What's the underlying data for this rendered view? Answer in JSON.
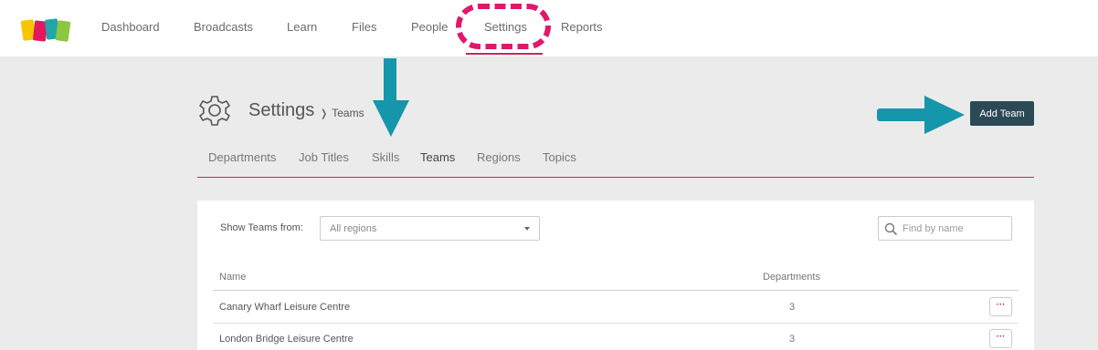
{
  "nav": {
    "items": [
      {
        "label": "Dashboard"
      },
      {
        "label": "Broadcasts"
      },
      {
        "label": "Learn"
      },
      {
        "label": "Files"
      },
      {
        "label": "People"
      },
      {
        "label": "Settings"
      },
      {
        "label": "Reports"
      }
    ],
    "active": "Settings"
  },
  "header": {
    "title": "Settings",
    "breadcrumb": "Teams",
    "add_button": "Add Team"
  },
  "tabs": [
    {
      "label": "Departments"
    },
    {
      "label": "Job Titles"
    },
    {
      "label": "Skills"
    },
    {
      "label": "Teams"
    },
    {
      "label": "Regions"
    },
    {
      "label": "Topics"
    }
  ],
  "active_tab": "Teams",
  "filter": {
    "label": "Show Teams from:",
    "selected": "All regions",
    "search_placeholder": "Find by name"
  },
  "table": {
    "columns": [
      "Name",
      "Departments"
    ],
    "rows": [
      {
        "name": "Canary Wharf Leisure Centre",
        "departments": "3",
        "more": "···"
      },
      {
        "name": "London Bridge Leisure Centre",
        "departments": "3",
        "more": "···"
      }
    ]
  },
  "colors": {
    "accent": "#c8285a",
    "button": "#2c4a55",
    "annotation_arrow": "#1596aa",
    "annotation_circle": "#e0186c"
  }
}
